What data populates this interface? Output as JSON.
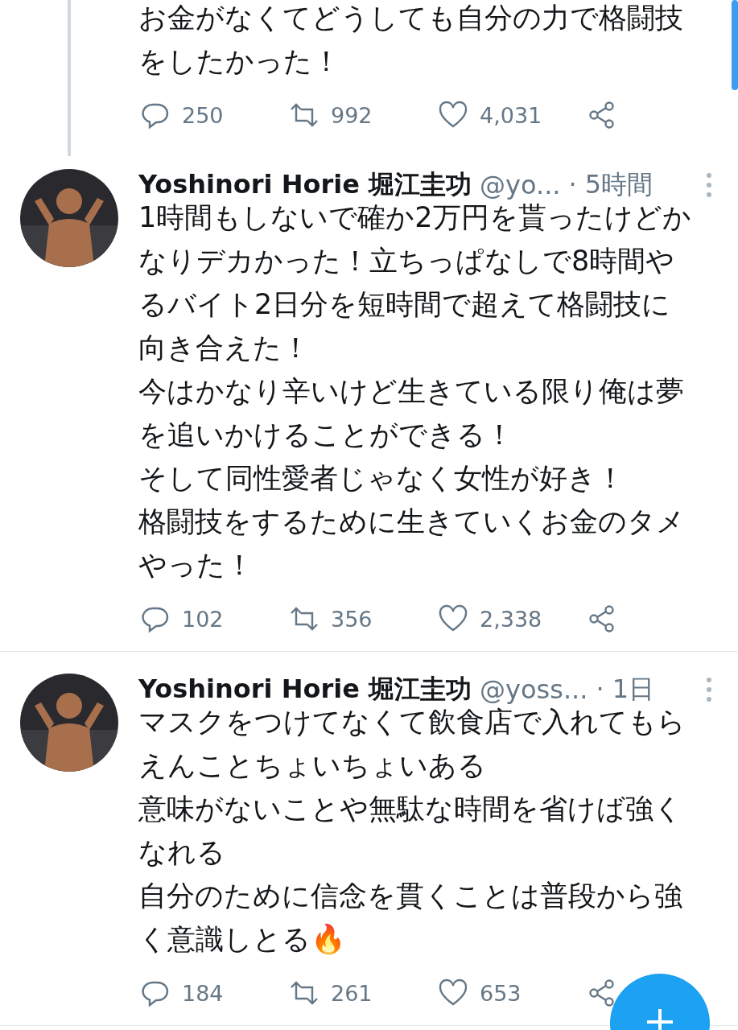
{
  "tweets": [
    {
      "paragraphs": [
        "お金がなくてどうしても自分の力で格闘技をしたかった！"
      ],
      "thread_line": true,
      "actions": {
        "replies": "250",
        "retweets": "992",
        "likes": "4,031"
      }
    },
    {
      "author": {
        "name": "Yoshinori Horie 堀江圭功",
        "handle": "@yo...",
        "time": "· 5時間"
      },
      "paragraphs": [
        "1時間もしないで確か2万円を貰ったけどかなりデカかった！立ちっぱなしで8時間やるバイト2日分を短時間で超えて格闘技に向き合えた！",
        "今はかなり辛いけど生きている限り俺は夢を追いかけることができる！",
        "そして同性愛者じゃなく女性が好き！",
        "格闘技をするために生きていくお金のタメやった！"
      ],
      "thread_line": false,
      "actions": {
        "replies": "102",
        "retweets": "356",
        "likes": "2,338"
      }
    },
    {
      "author": {
        "name": "Yoshinori Horie 堀江圭功",
        "handle": "@yoss...",
        "time": "· 1日"
      },
      "paragraphs": [
        "マスクをつけてなくて飲食店で入れてもらえんことちょいちょいある",
        "意味がないことや無駄な時間を省けば強くなれる",
        "自分のために信念を貫くことは普段から強く意識しとる🔥"
      ],
      "thread_line": false,
      "actions": {
        "replies": "184",
        "retweets": "261",
        "likes": "653"
      }
    }
  ]
}
